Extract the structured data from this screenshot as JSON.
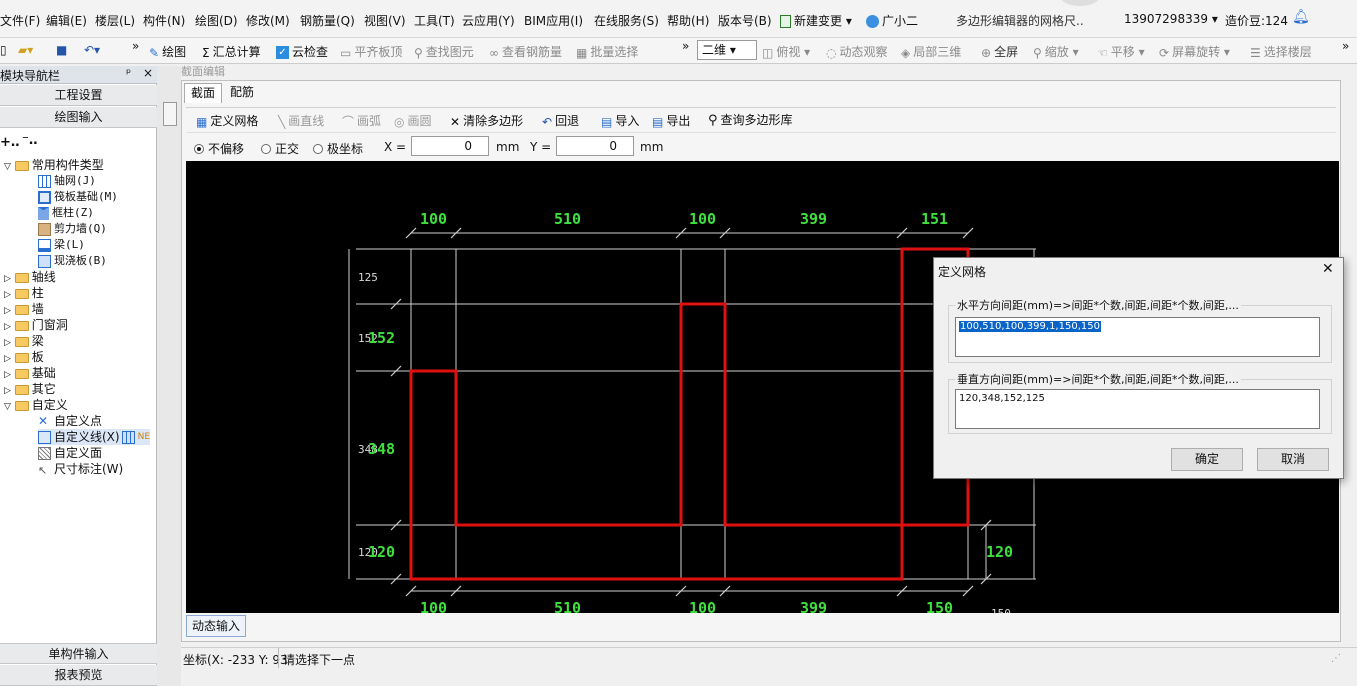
{
  "menubar": {
    "items": [
      "文件(F)",
      "编辑(E)",
      "楼层(L)",
      "构件(N)",
      "绘图(D)",
      "修改(M)",
      "钢筋量(Q)",
      "视图(V)",
      "工具(T)",
      "云应用(Y)",
      "BIM应用(I)",
      "在线服务(S)",
      "帮助(H)",
      "版本号(B)"
    ],
    "new_change": "新建变更",
    "assistant": "广小二",
    "window_title": "多边形编辑器的网格尺..",
    "phone": "13907298339",
    "price_beans": "造价豆:124"
  },
  "toolbar": {
    "draw": "绘图",
    "sum_calc": "汇总计算",
    "cloud_check": "云检查",
    "flat_slab_top": "平齐板顶",
    "find_element": "查找图元",
    "view_rebar": "查看钢筋量",
    "batch_select": "批量选择",
    "view_mode": "二维",
    "plan_view": "俯视",
    "dynamic_observe": "动态观察",
    "local_3d": "局部三维",
    "full_screen": "全屏",
    "zoom": "缩放",
    "pan": "平移",
    "screen_rotate": "屏幕旋转",
    "select_floor": "选择楼层"
  },
  "left_panel": {
    "title": "模块导航栏",
    "pin": "ᵖ",
    "close": "×",
    "project_settings": "工程设置",
    "drawing_input": "绘图输入",
    "tree": {
      "common_types": "常用构件类型",
      "common_items": [
        "轴网(J)",
        "筏板基础(M)",
        "框柱(Z)",
        "剪力墙(Q)",
        "梁(L)",
        "现浇板(B)"
      ],
      "categories": [
        "轴线",
        "柱",
        "墙",
        "门窗洞",
        "梁",
        "板",
        "基础",
        "其它"
      ],
      "custom": "自定义",
      "custom_items": [
        "自定义点",
        "自定义线(X)",
        "自定义面",
        "尺寸标注(W)"
      ],
      "new_badge": "NE"
    },
    "single_input": "单构件输入",
    "report_preview": "报表预览"
  },
  "editor": {
    "panel_title": "截面编辑",
    "tabs": [
      "截面",
      "配筋"
    ],
    "tools": {
      "define_grid": "定义网格",
      "draw_line": "画直线",
      "draw_arc": "画弧",
      "draw_circle": "画圆",
      "clear_polygon": "清除多边形",
      "undo": "回退",
      "import": "导入",
      "export": "导出",
      "query_library": "查询多边形库"
    },
    "coord": {
      "no_offset": "不偏移",
      "orthogonal": "正交",
      "polar": "极坐标",
      "x_label": "X =",
      "x_value": "0",
      "y_label": "Y =",
      "y_value": "0",
      "unit": "mm"
    },
    "dynamic_input": "动态输入"
  },
  "canvas": {
    "top_dims": [
      "100",
      "510",
      "100",
      "399",
      "151"
    ],
    "bottom_dims": [
      "100",
      "510",
      "100",
      "399",
      "150"
    ],
    "right_dim": "120",
    "left_small": [
      "125",
      "152",
      "348",
      "120"
    ],
    "left_big": [
      "152",
      "348",
      "120"
    ],
    "extra_label": "150",
    "colors": {
      "background": "#000000",
      "grid": "#cfcfcf",
      "shape": "#e01010",
      "dimension": "#3ee03e"
    }
  },
  "dialog": {
    "title": "定义网格",
    "close": "✕",
    "horizontal_label": "水平方向间距(mm)=>间距*个数,间距,间距*个数,间距,...",
    "horizontal_value": "100,510,100,399,1,150,150",
    "vertical_label": "垂直方向间距(mm)=>间距*个数,间距,间距*个数,间距,...",
    "vertical_value": "120,348,152,125",
    "ok": "确定",
    "cancel": "取消"
  },
  "status": {
    "coords": "坐标(X: -233 Y: 93",
    "prompt": "请选择下一点"
  }
}
